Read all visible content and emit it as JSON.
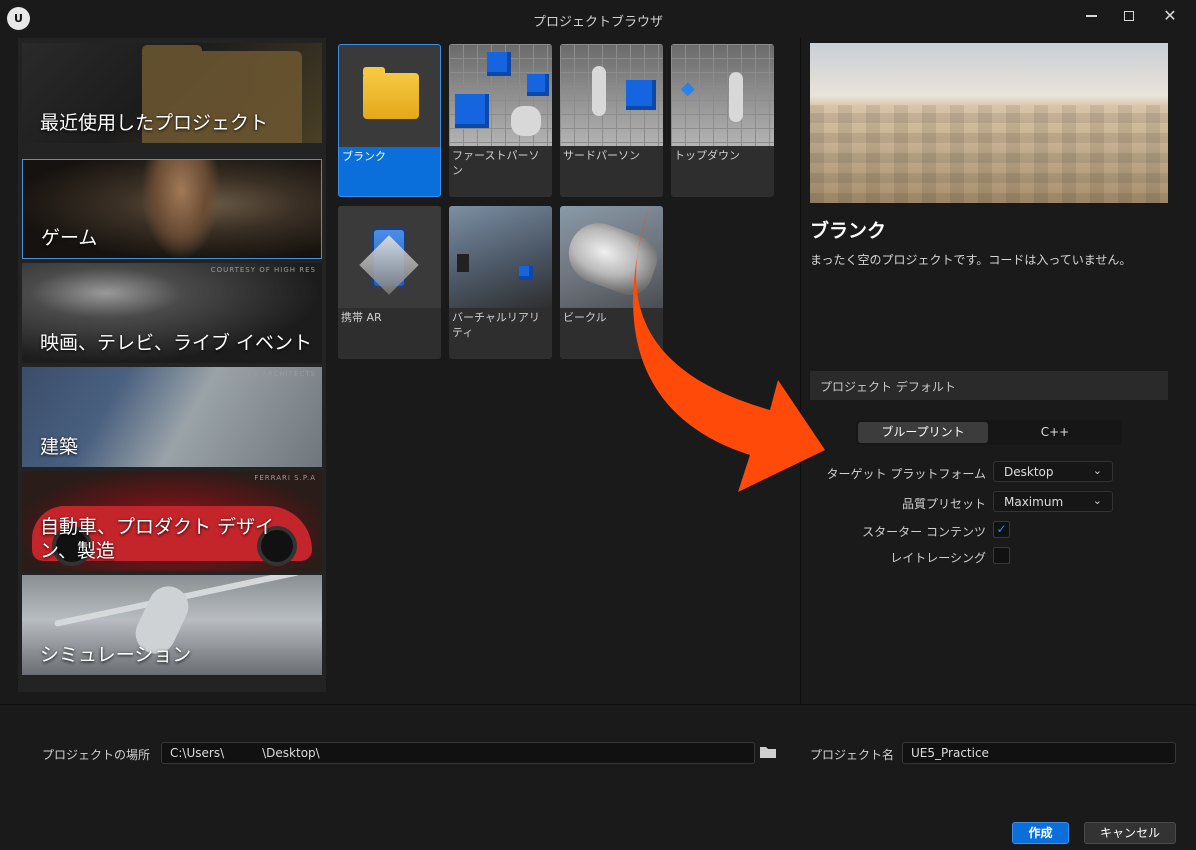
{
  "window": {
    "title": "プロジェクトブラウザ",
    "logo_text": "U"
  },
  "categories": [
    {
      "label": "最近使用したプロジェクト",
      "credit": ""
    },
    {
      "label": "ゲーム",
      "credit": ""
    },
    {
      "label": "映画、テレビ、ライブ イベント",
      "credit": "COURTESY OF HIGH RES"
    },
    {
      "label": "建築",
      "credit": "SAFDIE ARCHITECTS"
    },
    {
      "label": "自動車、プロダクト デザイン、製造",
      "credit": "FERRARI S.P.A"
    },
    {
      "label": "シミュレーション",
      "credit": ""
    }
  ],
  "templates": [
    {
      "label": "ブランク"
    },
    {
      "label": "ファーストパーソン"
    },
    {
      "label": "サードパーソン"
    },
    {
      "label": "トップダウン"
    },
    {
      "label": "携帯 AR"
    },
    {
      "label": "バーチャルリアリティ"
    },
    {
      "label": "ビークル"
    }
  ],
  "detail": {
    "title": "ブランク",
    "description": "まったく空のプロジェクトです。コードは入っていません。"
  },
  "defaults": {
    "section_title": "プロジェクト デフォルト",
    "blueprint_label": "ブループリント",
    "cpp_label": "C++",
    "target_platform_label": "ターゲット プラットフォーム",
    "target_platform_value": "Desktop",
    "quality_preset_label": "品質プリセット",
    "quality_preset_value": "Maximum",
    "starter_content_label": "スターター コンテンツ",
    "starter_content_checked": true,
    "raytracing_label": "レイトレーシング",
    "raytracing_checked": false
  },
  "footer": {
    "location_label": "プロジェクトの場所",
    "location_prefix": "C:\\Users\\",
    "location_suffix": "\\Desktop\\",
    "name_label": "プロジェクト名",
    "name_value": "UE5_Practice",
    "create_label": "作成",
    "cancel_label": "キャンセル"
  },
  "colors": {
    "accent": "#0a6fdb",
    "annotation_arrow": "#ff4a0a",
    "background": "#1a1a1a"
  }
}
